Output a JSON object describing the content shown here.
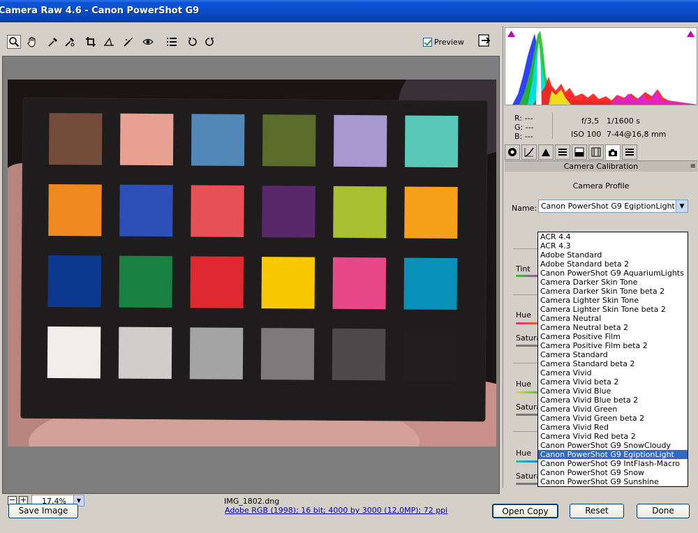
{
  "window": {
    "title": "Camera Raw 4.6  -  Canon PowerShot G9"
  },
  "toolbar": {
    "tools": [
      "zoom-icon",
      "hand-icon",
      "white-balance-icon",
      "color-sampler-icon",
      "crop-icon",
      "straighten-icon",
      "retouch-icon",
      "red-eye-icon",
      "preferences-icon",
      "rotate-left-icon",
      "rotate-right-icon"
    ],
    "preview_label": "Preview",
    "preview_checked": true
  },
  "canvas": {
    "zoom_value": "17,4%",
    "filename": "IMG_1802.dng",
    "patches": [
      "#744c3c",
      "#e8a090",
      "#5288b8",
      "#5a6c2c",
      "#a898d0",
      "#58c8b8",
      "#f08820",
      "#2c50b8",
      "#e85058",
      "#582868",
      "#a8c030",
      "#f8a018",
      "#0c3890",
      "#188040",
      "#e02830",
      "#f8c800",
      "#e84888",
      "#0890b8",
      "#f0eeec",
      "#d0cecc",
      "#a4a4a4",
      "#7c7a7a",
      "#4c4a4a",
      "#201e1e"
    ]
  },
  "footer": {
    "save_label": "Save Image",
    "info_link": "Adobe RGB (1998); 16 bit; 4000 by 3000 (12,0MP); 72 ppi",
    "open_copy_label": "Open Copy",
    "reset_label": "Reset",
    "done_label": "Done"
  },
  "readout": {
    "r": "R:  ---",
    "g": "G:  ---",
    "b": "B:  ---",
    "aperture": "f/3,5",
    "shutter": "1/1600 s",
    "iso": "ISO 100",
    "lens": "7-44@16,8 mm"
  },
  "panel": {
    "tabs": [
      "basic-icon",
      "tone-curve-icon",
      "detail-icon",
      "hsl-icon",
      "split-toning-icon",
      "lens-icon",
      "camera-calibration-icon",
      "presets-icon"
    ],
    "header": "Camera Calibration",
    "menu_glyph": "≡",
    "profile_title": "Camera Profile",
    "name_label": "Name:",
    "name_value": "Canon PowerShot G9 EgiptionLight",
    "slider_labels": {
      "tint": "Tint",
      "hue1": "Hue",
      "sat1": "Satura",
      "hue2": "Hue",
      "sat2": "Satura",
      "hue3": "Hue",
      "sat3": "Satura"
    }
  },
  "dropdown": {
    "options": [
      "ACR 4.4",
      "ACR 4.3",
      "Adobe Standard",
      "Adobe Standard beta 2",
      "Canon PowerShot G9 AquariumLights",
      "Camera Darker Skin Tone",
      "Camera Darker Skin Tone beta 2",
      "Camera Lighter Skin Tone",
      "Camera Lighter Skin Tone beta 2",
      "Camera Neutral",
      "Camera Neutral beta 2",
      "Camera Positive Film",
      "Camera Positive Film beta 2",
      "Camera Standard",
      "Camera Standard beta 2",
      "Camera Vivid",
      "Camera Vivid beta 2",
      "Camera Vivid Blue",
      "Camera Vivid Blue beta 2",
      "Camera Vivid Green",
      "Camera Vivid Green beta 2",
      "Camera Vivid Red",
      "Camera Vivid Red beta 2",
      "Canon PowerShot G9 SnowCloudy",
      "Canon PowerShot G9 EgiptionLight",
      "Canon PowerShot G9 IntFlash-Macro",
      "Canon PowerShot G9 Snow",
      "Canon PowerShot G9 Sunshine"
    ],
    "selected": "Canon PowerShot G9 EgiptionLight"
  },
  "colors": {
    "title_bar": "#0a4cc7",
    "selection": "#316ac5",
    "link": "#0000cc"
  }
}
